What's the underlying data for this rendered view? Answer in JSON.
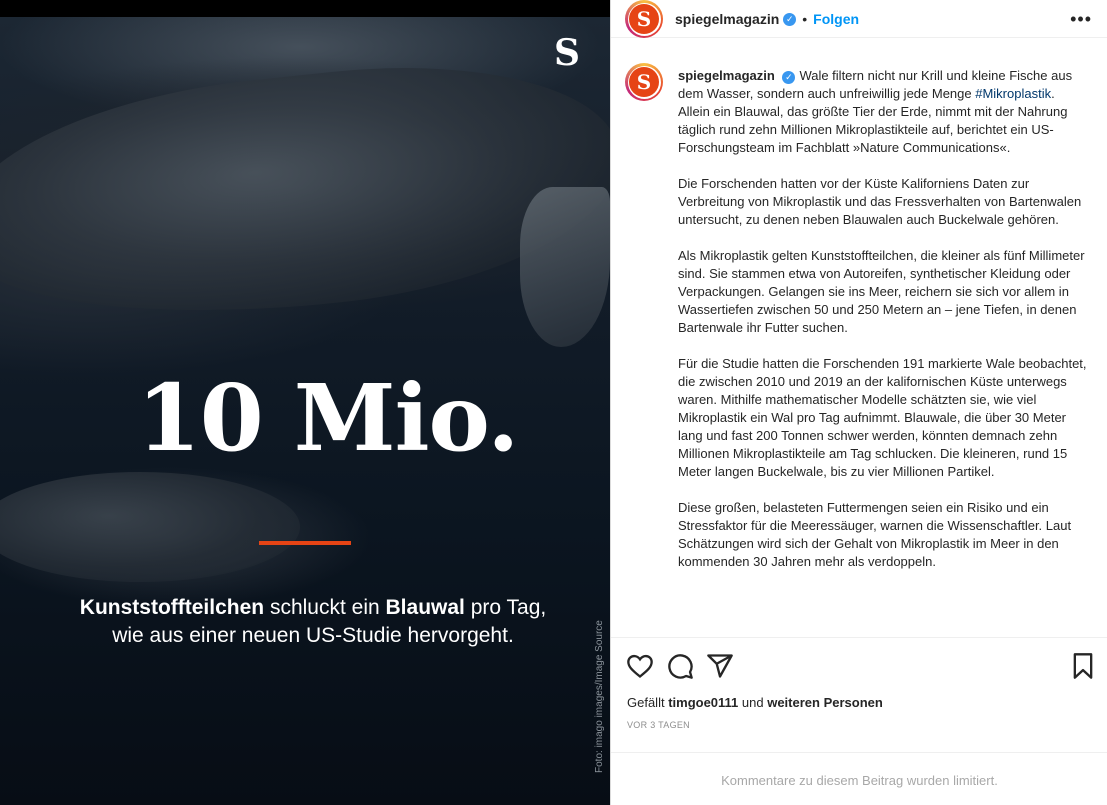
{
  "media": {
    "brand_letter": "S",
    "big_number": "10 Mio.",
    "caption_bold_1": "Kunststoffteilchen",
    "caption_text_1": " schluckt ein ",
    "caption_bold_2": "Blauwal",
    "caption_text_2": " pro Tag,",
    "caption_line_2": "wie aus einer neuen US-Studie hervorgeht.",
    "photo_credit": "Foto: imago images/Image Source",
    "accent_color": "#e64415"
  },
  "header": {
    "avatar_letter": "S",
    "username": "spiegelmagazin",
    "separator": "•",
    "follow_label": "Folgen",
    "more_icon": "more-horizontal-icon"
  },
  "post": {
    "username": "spiegelmagazin",
    "intro_before_tag": "Wale filtern nicht nur Krill und kleine Fische aus dem Wasser, sondern auch unfreiwillig jede Menge ",
    "hashtag": "#Mikroplastik",
    "intro_after_tag": ". Allein ein Blauwal, das größte Tier der Erde, nimmt mit der Nahrung täglich rund zehn Millionen Mikroplastikteile auf, berichtet ein US-Forschungsteam im Fachblatt »Nature Communications«.",
    "paragraph_2": "Die Forschenden hatten vor der Küste Kaliforniens Daten zur Verbreitung von Mikroplastik und das Fressverhalten von Bartenwalen untersucht, zu denen neben Blauwalen auch Buckelwale gehören.",
    "paragraph_3": "Als Mikroplastik gelten Kunststoffteilchen, die kleiner als fünf Millimeter sind. Sie stammen etwa von Autoreifen, synthetischer Kleidung oder Verpackungen. Gelangen sie ins Meer, reichern sie sich vor allem in Wassertiefen zwischen 50 und 250 Metern an – jene Tiefen, in denen Bartenwale ihr Futter suchen.",
    "paragraph_4": "Für die Studie hatten die Forschenden 191 markierte Wale beobachtet, die zwischen 2010 und 2019 an der kalifornischen Küste unterwegs waren. Mithilfe mathematischer Modelle schätzten sie, wie viel Mikroplastik ein Wal pro Tag aufnimmt. Blauwale, die über 30 Meter lang und fast 200 Tonnen schwer werden, könnten demnach zehn Millionen Mikroplastikteile am Tag schlucken. Die kleineren, rund 15 Meter langen Buckelwale, bis zu vier Millionen Partikel.",
    "paragraph_5": "Diese großen, belasteten Futtermengen seien ein Risiko und ein Stressfaktor für die Meeressäuger, warnen die Wissenschaftler. Laut Schätzungen wird sich der Gehalt von Mikroplastik im Meer in den kommenden 30 Jahren mehr als verdoppeln."
  },
  "actions": {
    "icons": [
      "heart-icon",
      "comment-icon",
      "share-icon",
      "bookmark-icon"
    ],
    "likes_prefix": "Gefällt ",
    "likes_user": "timgoe0111",
    "likes_middle": " und ",
    "likes_others": "weiteren Personen",
    "time_ago": "VOR 3 TAGEN"
  },
  "footer": {
    "comment_limit": "Kommentare zu diesem Beitrag wurden limitiert."
  }
}
